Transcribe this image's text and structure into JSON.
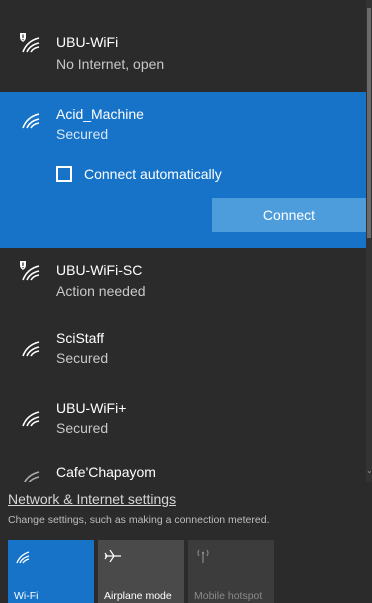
{
  "networks": [
    {
      "name": "UBU-WiFi",
      "status": "No Internet, open"
    },
    {
      "name": "Acid_Machine",
      "status": "Secured",
      "connect_auto_label": "Connect automatically",
      "connect_label": "Connect"
    },
    {
      "name": "UBU-WiFi-SC",
      "status": "Action needed"
    },
    {
      "name": "SciStaff",
      "status": "Secured"
    },
    {
      "name": "UBU-WiFi+",
      "status": "Secured"
    },
    {
      "name": "Cafe'Chapayom",
      "status": ""
    }
  ],
  "settings": {
    "link": "Network & Internet settings",
    "description": "Change settings, such as making a connection metered."
  },
  "quick_actions": [
    {
      "label": "Wi-Fi",
      "icon": "wifi-icon",
      "state": "on"
    },
    {
      "label": "Airplane mode",
      "icon": "airplane-icon",
      "state": "off"
    },
    {
      "label": "Mobile hotspot",
      "icon": "hotspot-icon",
      "state": "disabled"
    }
  ],
  "colors": {
    "accent": "#1673c8",
    "connect_button": "#4d9ddd",
    "flyout_background": "#2b2b2b"
  }
}
